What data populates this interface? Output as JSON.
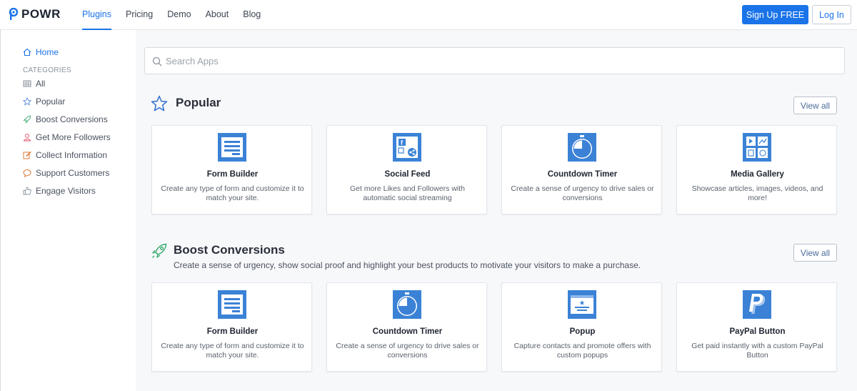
{
  "brand": {
    "name": "POWR",
    "accent": "#1a73e8"
  },
  "nav": {
    "items": [
      "Plugins",
      "Pricing",
      "Demo",
      "About",
      "Blog"
    ],
    "active": "Plugins",
    "signup_label": "Sign Up FREE",
    "login_label": "Log In"
  },
  "sidebar": {
    "home_label": "Home",
    "categories_heading": "CATEGORIES",
    "items": [
      {
        "label": "All",
        "icon": "grid-icon"
      },
      {
        "label": "Popular",
        "icon": "star-icon"
      },
      {
        "label": "Boost Conversions",
        "icon": "rocket-icon"
      },
      {
        "label": "Get More Followers",
        "icon": "user-icon"
      },
      {
        "label": "Collect Information",
        "icon": "edit-icon"
      },
      {
        "label": "Support Customers",
        "icon": "chat-icon"
      },
      {
        "label": "Engage Visitors",
        "icon": "thumbs-up-icon"
      }
    ]
  },
  "search": {
    "placeholder": "Search Apps"
  },
  "sections": [
    {
      "title": "Popular",
      "icon": "star-icon",
      "description": "",
      "view_all_label": "View all",
      "cards": [
        {
          "title": "Form Builder",
          "description": "Create any type of form and customize it to match your site.",
          "icon": "form-builder-icon"
        },
        {
          "title": "Social Feed",
          "description": "Get more Likes and Followers with automatic social streaming",
          "icon": "social-feed-icon"
        },
        {
          "title": "Countdown Timer",
          "description": "Create a sense of urgency to drive sales or conversions",
          "icon": "countdown-timer-icon"
        },
        {
          "title": "Media Gallery",
          "description": "Showcase articles, images, videos, and more!",
          "icon": "media-gallery-icon"
        }
      ]
    },
    {
      "title": "Boost Conversions",
      "icon": "rocket-icon",
      "description": "Create a sense of urgency, show social proof and highlight your best products to motivate your visitors to make a purchase.",
      "view_all_label": "View all",
      "cards": [
        {
          "title": "Form Builder",
          "description": "Create any type of form and customize it to match your site.",
          "icon": "form-builder-icon"
        },
        {
          "title": "Countdown Timer",
          "description": "Create a sense of urgency to drive sales or conversions",
          "icon": "countdown-timer-icon"
        },
        {
          "title": "Popup",
          "description": "Capture contacts and promote offers with custom popups",
          "icon": "popup-icon"
        },
        {
          "title": "PayPal Button",
          "description": "Get paid instantly with a custom PayPal Button",
          "icon": "paypal-icon"
        }
      ]
    }
  ]
}
